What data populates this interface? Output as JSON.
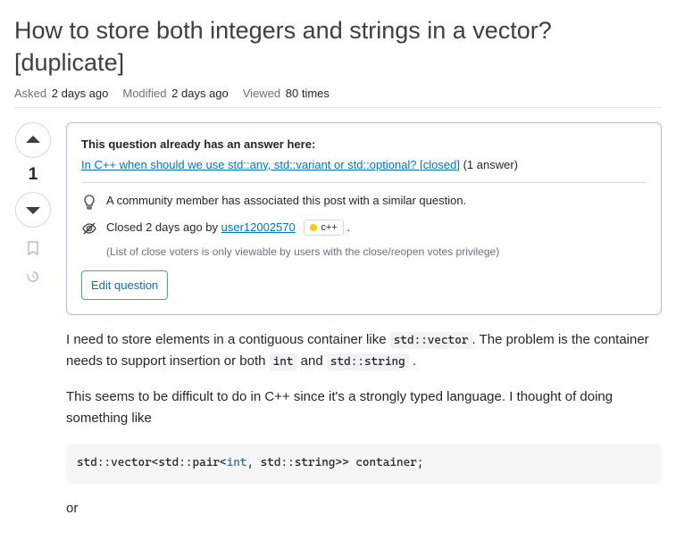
{
  "title": "How to store both integers and strings in a vector? [duplicate]",
  "meta": {
    "asked_label": "Asked",
    "asked_value": "2 days ago",
    "modified_label": "Modified",
    "modified_value": "2 days ago",
    "viewed_label": "Viewed",
    "viewed_value": "80 times"
  },
  "vote": {
    "count": "1"
  },
  "notice": {
    "heading": "This question already has an answer here",
    "dup_link": "In C++ when should we use std::any, std::variant or std::optional? [closed]",
    "dup_count": "(1 answer)",
    "associated": "A community member has associated this post with a similar question.",
    "closed_prefix": "Closed 2 days ago by ",
    "closer": "user12002570",
    "badge": "c++",
    "period": ".",
    "privilege": "(List of close voters is only viewable by users with the close/reopen votes privilege)",
    "edit_label": "Edit question"
  },
  "body": {
    "p1_a": "I need to store elements in a contiguous container like ",
    "code1": "std::vector",
    "p1_b": ". The problem is the container needs to support insertion or both ",
    "code2": "int",
    "p1_c": " and ",
    "code3": "std::string",
    "p1_d": " .",
    "p2": "This seems to be difficult to do in C++ since it's a strongly typed language. I thought of doing something like",
    "block_a": "std::vector<std::pair<",
    "block_type": "int",
    "block_b": ", std::string>> container;",
    "p3": "or"
  }
}
